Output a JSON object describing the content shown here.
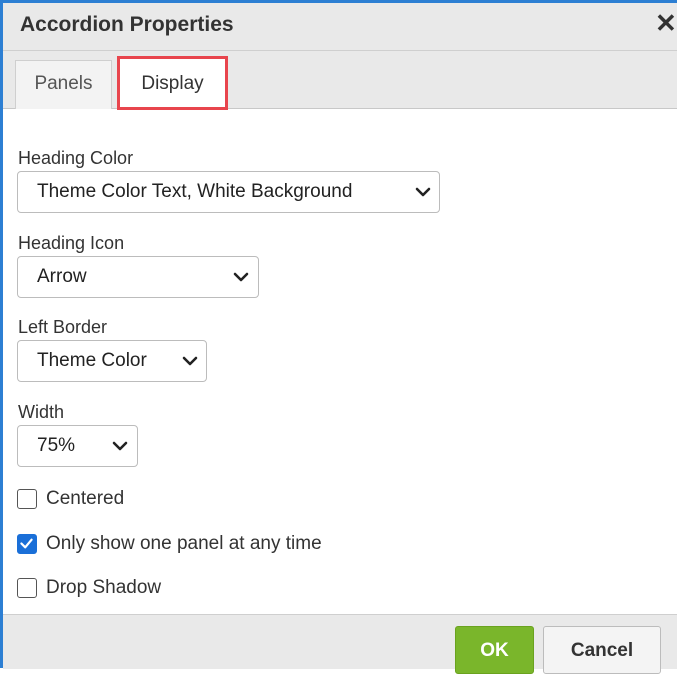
{
  "dialog": {
    "title": "Accordion Properties",
    "close_icon": "close-icon"
  },
  "tabs": [
    {
      "label": "Panels",
      "active": false
    },
    {
      "label": "Display",
      "active": true
    }
  ],
  "fields": {
    "heading_color": {
      "label": "Heading Color",
      "value": "Theme Color Text, White Background"
    },
    "heading_icon": {
      "label": "Heading Icon",
      "value": "Arrow"
    },
    "left_border": {
      "label": "Left Border",
      "value": "Theme Color"
    },
    "width": {
      "label": "Width",
      "value": "75%"
    }
  },
  "checkboxes": [
    {
      "label": "Centered",
      "checked": false
    },
    {
      "label": "Only show one panel at any time",
      "checked": true
    },
    {
      "label": "Drop Shadow",
      "checked": false
    }
  ],
  "buttons": {
    "ok": "OK",
    "cancel": "Cancel"
  },
  "colors": {
    "accent_blue": "#2d7fd3",
    "tab_highlight": "#e8454d",
    "ok_green": "#7ab62b",
    "checkbox_blue": "#1a6fd8"
  }
}
